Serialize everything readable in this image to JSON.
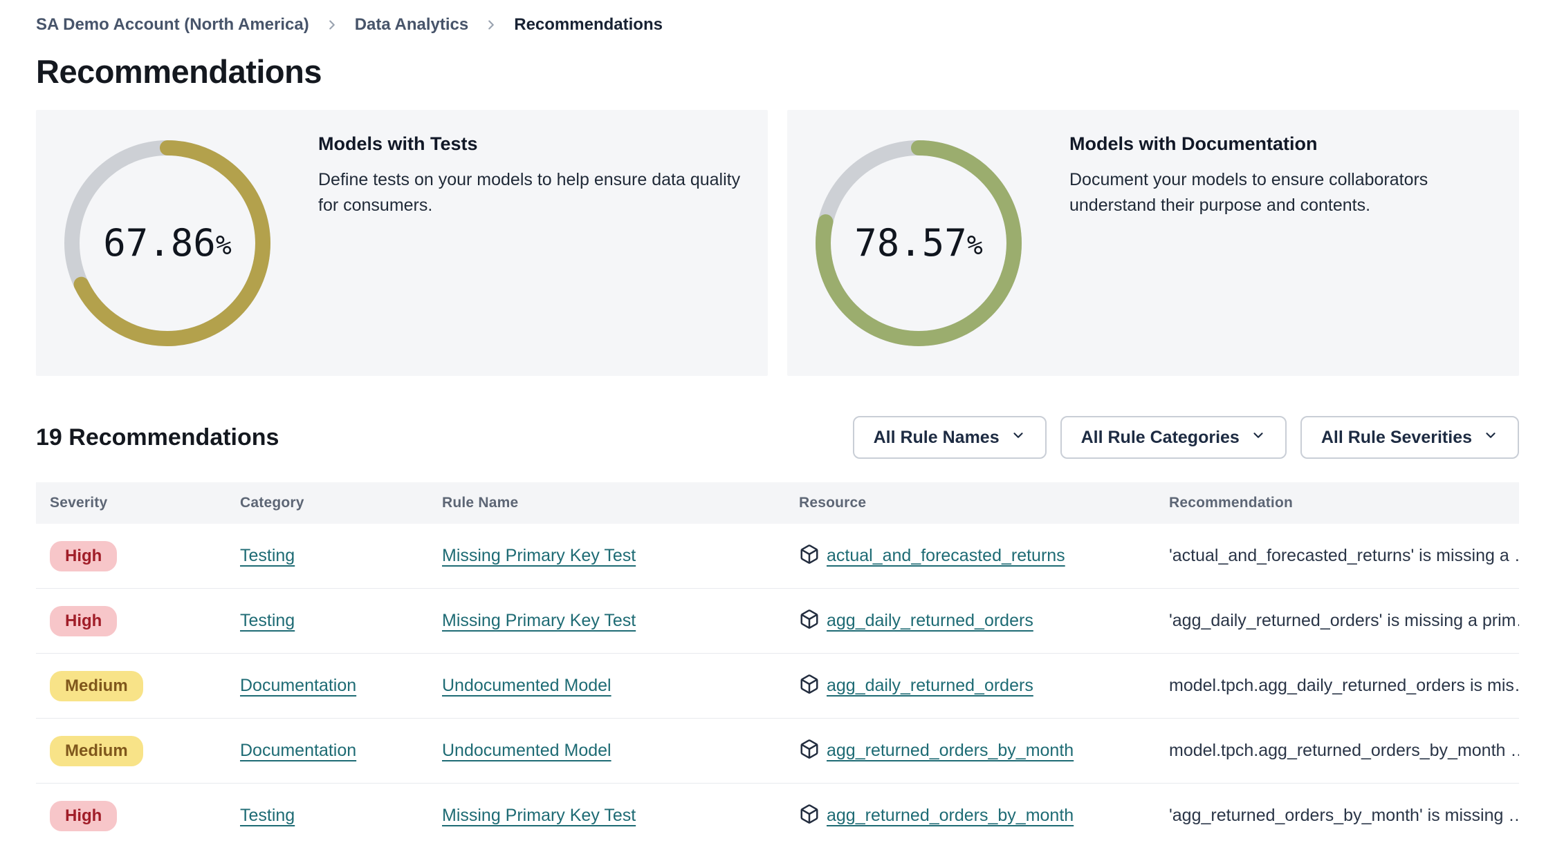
{
  "breadcrumb": {
    "items": [
      {
        "label": "SA Demo Account (North America)"
      },
      {
        "label": "Data Analytics"
      },
      {
        "label": "Recommendations"
      }
    ]
  },
  "page": {
    "title": "Recommendations"
  },
  "chart_data": [
    {
      "type": "donut",
      "title": "Models with Tests",
      "description": "Define tests on your models to help ensure data quality for consumers.",
      "value": 67.86,
      "value_label": "67.86",
      "unit": "%",
      "color": "#b3a14c",
      "track_color": "#cdd0d5"
    },
    {
      "type": "donut",
      "title": "Models with Documentation",
      "description": "Document your models to ensure collaborators understand their purpose and contents.",
      "value": 78.57,
      "value_label": "78.57",
      "unit": "%",
      "color": "#9bad6e",
      "track_color": "#cdd0d5"
    }
  ],
  "list_header": {
    "title": "19 Recommendations",
    "filters": [
      {
        "label": "All Rule Names"
      },
      {
        "label": "All Rule Categories"
      },
      {
        "label": "All Rule Severities"
      }
    ]
  },
  "table": {
    "columns": [
      "Severity",
      "Category",
      "Rule Name",
      "Resource",
      "Recommendation"
    ],
    "rows": [
      {
        "severity": "High",
        "category": "Testing",
        "rule_name": "Missing Primary Key Test",
        "resource": "actual_and_forecasted_returns",
        "recommendation": "'actual_and_forecasted_returns' is missing a …"
      },
      {
        "severity": "High",
        "category": "Testing",
        "rule_name": "Missing Primary Key Test",
        "resource": "agg_daily_returned_orders",
        "recommendation": "'agg_daily_returned_orders' is missing a prim…"
      },
      {
        "severity": "Medium",
        "category": "Documentation",
        "rule_name": "Undocumented Model",
        "resource": "agg_daily_returned_orders",
        "recommendation": "model.tpch.agg_daily_returned_orders is mis…"
      },
      {
        "severity": "Medium",
        "category": "Documentation",
        "rule_name": "Undocumented Model",
        "resource": "agg_returned_orders_by_month",
        "recommendation": "model.tpch.agg_returned_orders_by_month …"
      },
      {
        "severity": "High",
        "category": "Testing",
        "rule_name": "Missing Primary Key Test",
        "resource": "agg_returned_orders_by_month",
        "recommendation": "'agg_returned_orders_by_month' is missing …"
      }
    ]
  },
  "colors": {
    "severity_high_bg": "#f7c6c9",
    "severity_high_text": "#a01d28",
    "severity_medium_bg": "#f8e388",
    "severity_medium_text": "#7f571c",
    "link": "#1e6b74",
    "card_bg": "#f5f6f8"
  }
}
